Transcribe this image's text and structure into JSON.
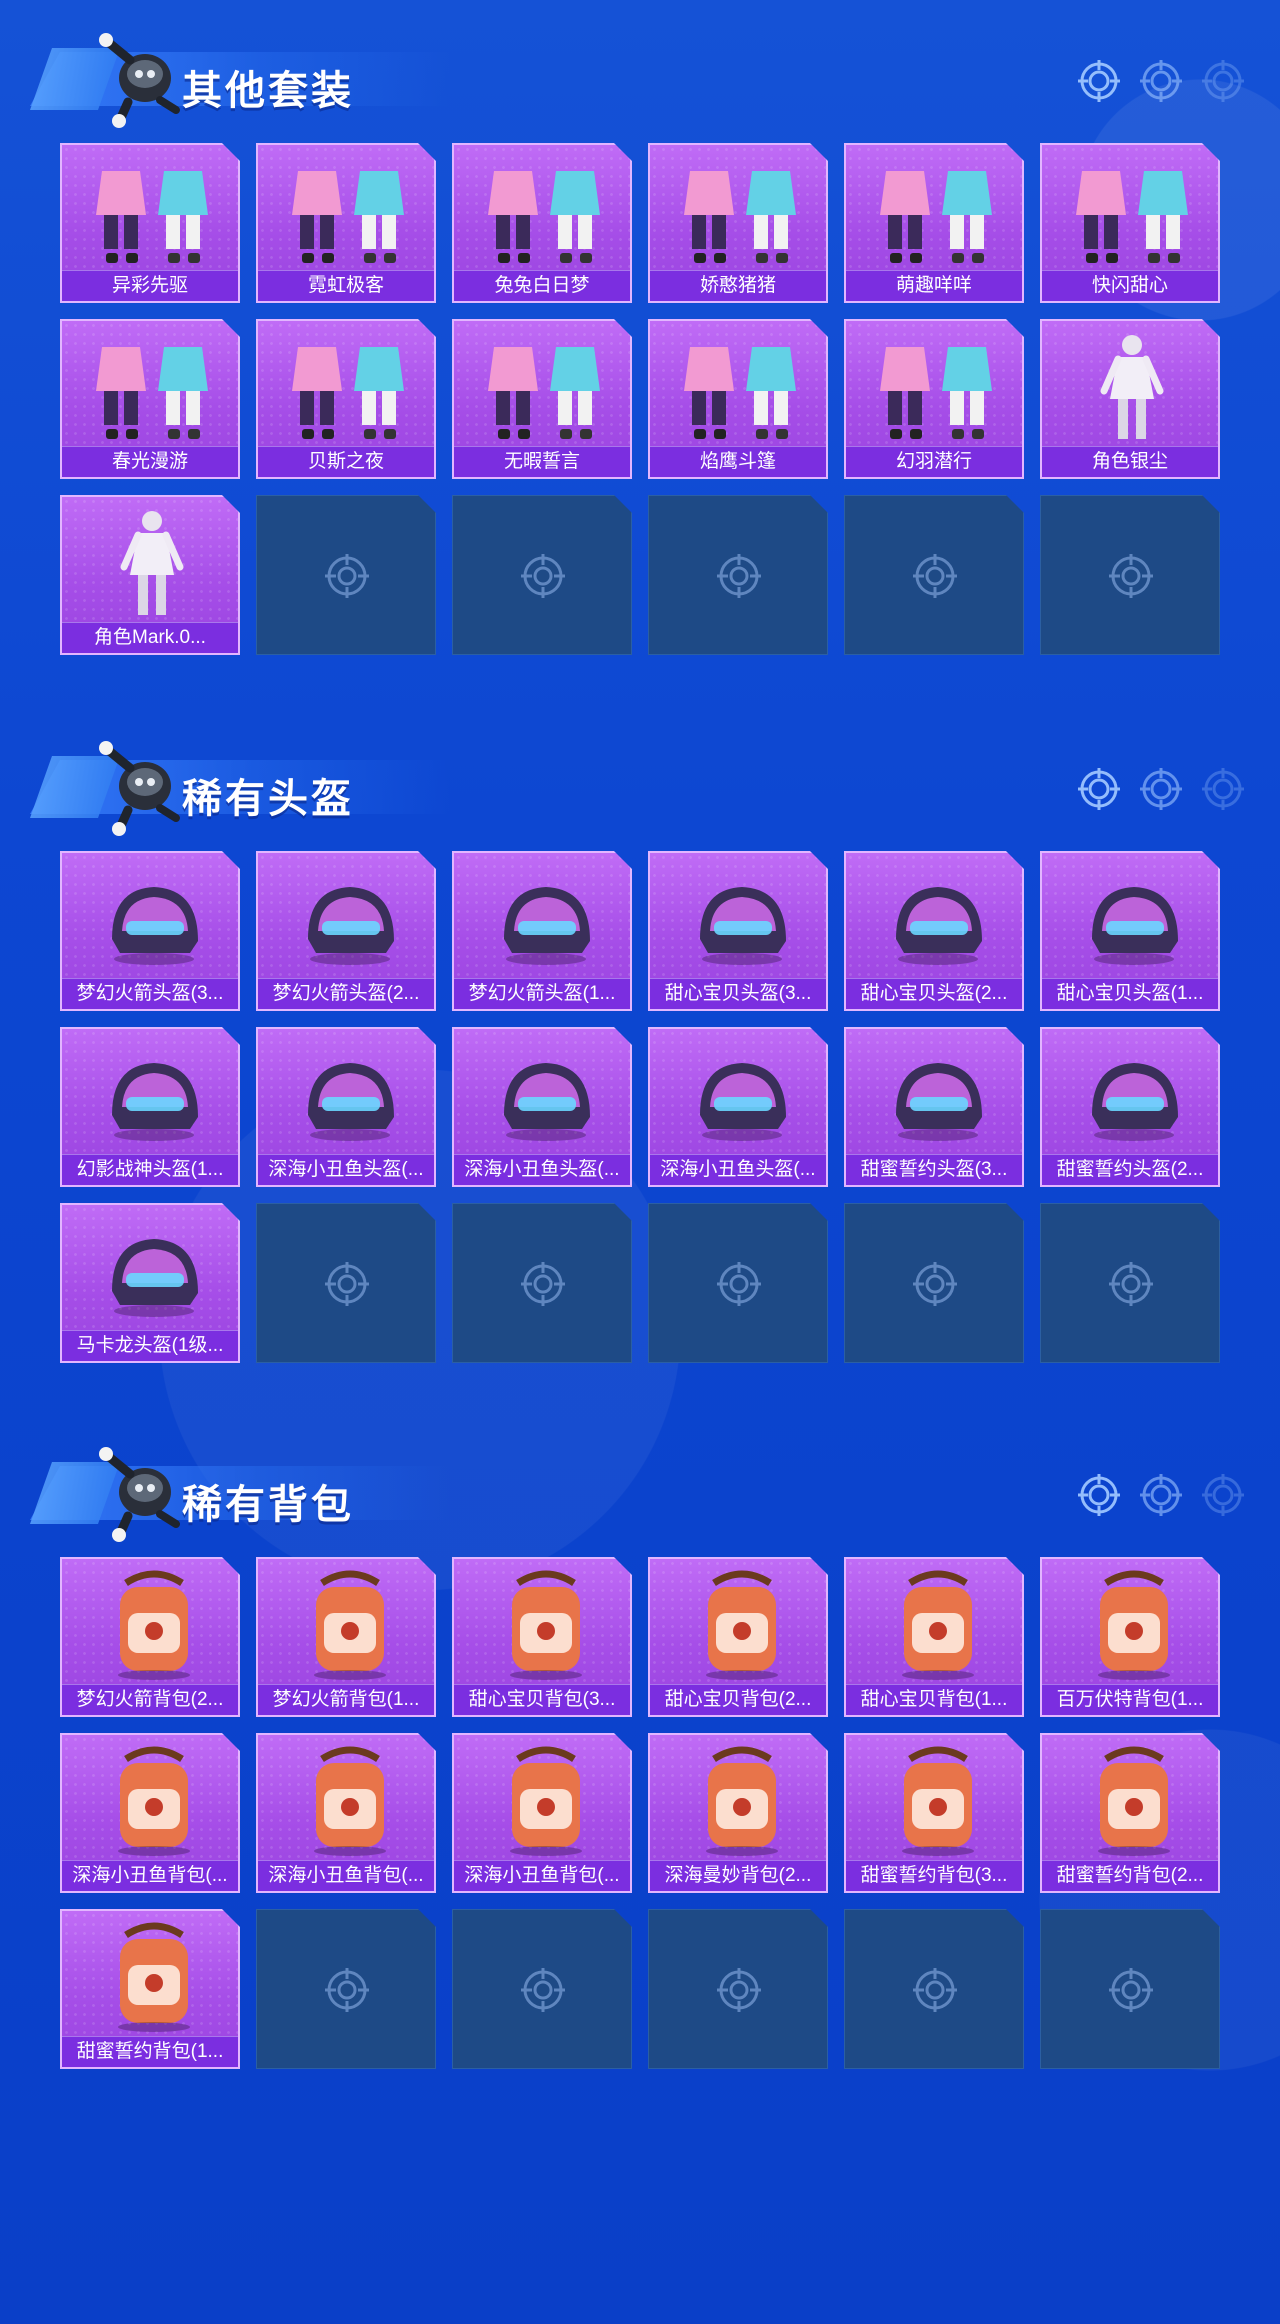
{
  "colors": {
    "background": "#0d47d2",
    "card": "#a64ee8",
    "label_bar": "#7b2ee0",
    "empty_card": "#1e4a86"
  },
  "sections": [
    {
      "title": "其他套装",
      "items": [
        {
          "label": "异彩先驱",
          "icon": "outfit-icon"
        },
        {
          "label": "霓虹极客",
          "icon": "outfit-icon"
        },
        {
          "label": "兔兔白日梦",
          "icon": "outfit-icon"
        },
        {
          "label": "娇憨猪猪",
          "icon": "outfit-icon"
        },
        {
          "label": "萌趣咩咩",
          "icon": "outfit-icon"
        },
        {
          "label": "快闪甜心",
          "icon": "outfit-icon"
        },
        {
          "label": "春光漫游",
          "icon": "outfit-icon"
        },
        {
          "label": "贝斯之夜",
          "icon": "outfit-icon"
        },
        {
          "label": "无暇誓言",
          "icon": "outfit-icon"
        },
        {
          "label": "焰鹰斗篷",
          "icon": "outfit-icon"
        },
        {
          "label": "幻羽潜行",
          "icon": "outfit-icon"
        },
        {
          "label": "角色银尘",
          "icon": "character-icon"
        },
        {
          "label": "角色Mark.0...",
          "icon": "character-icon"
        }
      ],
      "empty_slots": 5
    },
    {
      "title": "稀有头盔",
      "items": [
        {
          "label": "梦幻火箭头盔(3...",
          "icon": "helmet-icon"
        },
        {
          "label": "梦幻火箭头盔(2...",
          "icon": "helmet-icon"
        },
        {
          "label": "梦幻火箭头盔(1...",
          "icon": "helmet-icon"
        },
        {
          "label": "甜心宝贝头盔(3...",
          "icon": "helmet-icon"
        },
        {
          "label": "甜心宝贝头盔(2...",
          "icon": "helmet-icon"
        },
        {
          "label": "甜心宝贝头盔(1...",
          "icon": "helmet-icon"
        },
        {
          "label": "幻影战神头盔(1...",
          "icon": "helmet-icon"
        },
        {
          "label": "深海小丑鱼头盔(...",
          "icon": "helmet-icon"
        },
        {
          "label": "深海小丑鱼头盔(...",
          "icon": "helmet-icon"
        },
        {
          "label": "深海小丑鱼头盔(...",
          "icon": "helmet-icon"
        },
        {
          "label": "甜蜜誓约头盔(3...",
          "icon": "helmet-icon"
        },
        {
          "label": "甜蜜誓约头盔(2...",
          "icon": "helmet-icon"
        },
        {
          "label": "马卡龙头盔(1级...",
          "icon": "helmet-icon"
        }
      ],
      "empty_slots": 5
    },
    {
      "title": "稀有背包",
      "items": [
        {
          "label": "梦幻火箭背包(2...",
          "icon": "backpack-icon"
        },
        {
          "label": "梦幻火箭背包(1...",
          "icon": "backpack-icon"
        },
        {
          "label": "甜心宝贝背包(3...",
          "icon": "backpack-icon"
        },
        {
          "label": "甜心宝贝背包(2...",
          "icon": "backpack-icon"
        },
        {
          "label": "甜心宝贝背包(1...",
          "icon": "backpack-icon"
        },
        {
          "label": "百万伏特背包(1...",
          "icon": "backpack-icon"
        },
        {
          "label": "深海小丑鱼背包(...",
          "icon": "backpack-icon"
        },
        {
          "label": "深海小丑鱼背包(...",
          "icon": "backpack-icon"
        },
        {
          "label": "深海小丑鱼背包(...",
          "icon": "backpack-icon"
        },
        {
          "label": "深海曼妙背包(2...",
          "icon": "backpack-icon"
        },
        {
          "label": "甜蜜誓约背包(3...",
          "icon": "backpack-icon"
        },
        {
          "label": "甜蜜誓约背包(2...",
          "icon": "backpack-icon"
        },
        {
          "label": "甜蜜誓约背包(1...",
          "icon": "backpack-icon"
        }
      ],
      "empty_slots": 5
    }
  ]
}
